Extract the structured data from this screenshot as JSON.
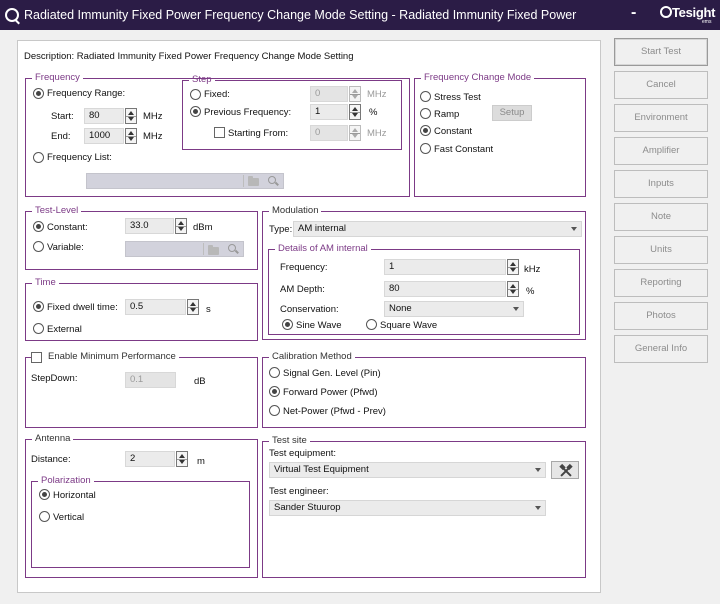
{
  "window": {
    "title": "Radiated Immunity Fixed Power Frequency Change Mode Setting - Radiated Immunity Fixed Power",
    "minimize_glyph": "-",
    "logo_text": "Tesight",
    "logo_subtext": "ems"
  },
  "description": "Description: Radiated Immunity Fixed Power Frequency Change Mode Setting",
  "frequency": {
    "legend": "Frequency",
    "range_label": "Frequency Range:",
    "start_label": "Start:",
    "start_value": "80",
    "start_unit": "MHz",
    "end_label": "End:",
    "end_value": "1000",
    "end_unit": "MHz",
    "list_label": "Frequency List:"
  },
  "step": {
    "legend": "Step",
    "fixed_label": "Fixed:",
    "fixed_value": "0",
    "fixed_unit": "MHz",
    "previous_label": "Previous Frequency:",
    "previous_value": "1",
    "previous_unit": "%",
    "starting_label": "Starting From:",
    "starting_value": "0",
    "starting_unit": "MHz"
  },
  "change_mode": {
    "legend": "Frequency Change Mode",
    "stress_label": "Stress Test",
    "ramp_label": "Ramp",
    "setup_label": "Setup",
    "constant_label": "Constant",
    "fast_label": "Fast Constant"
  },
  "test_level": {
    "legend": "Test-Level",
    "constant_label": "Constant:",
    "constant_value": "33.0",
    "constant_unit": "dBm",
    "variable_label": "Variable:"
  },
  "modulation": {
    "legend": "Modulation",
    "type_label": "Type:",
    "type_value": "AM internal",
    "details_legend": "Details of AM internal",
    "frequency_label": "Frequency:",
    "frequency_value": "1",
    "frequency_unit": "kHz",
    "depth_label": "AM Depth:",
    "depth_value": "80",
    "depth_unit": "%",
    "conservation_label": "Conservation:",
    "conservation_value": "None",
    "sine_label": "Sine Wave",
    "square_label": "Square Wave"
  },
  "time": {
    "legend": "Time",
    "dwell_label": "Fixed dwell time:",
    "dwell_value": "0.5",
    "dwell_unit": "s",
    "external_label": "External"
  },
  "min_perf": {
    "legend": "Enable Minimum Performance",
    "stepdown_label": "StepDown:",
    "stepdown_value": "0.1",
    "stepdown_unit": "dB"
  },
  "calibration": {
    "legend": "Calibration Method",
    "signal_label": "Signal Gen. Level (Pin)",
    "forward_label": "Forward Power (Pfwd)",
    "net_label": "Net-Power (Pfwd - Prev)"
  },
  "antenna": {
    "legend": "Antenna",
    "distance_label": "Distance:",
    "distance_value": "2",
    "distance_unit": "m",
    "polarization_legend": "Polarization",
    "horizontal_label": "Horizontal",
    "vertical_label": "Vertical"
  },
  "test_site": {
    "legend": "Test site",
    "equipment_label": "Test equipment:",
    "equipment_value": "Virtual Test Equipment",
    "engineer_label": "Test engineer:",
    "engineer_value": "Sander Stuurop"
  },
  "side_buttons": {
    "start_test": "Start Test",
    "cancel": "Cancel",
    "environment": "Environment",
    "amplifier": "Amplifier",
    "inputs": "Inputs",
    "note": "Note",
    "units": "Units",
    "reporting": "Reporting",
    "photos": "Photos",
    "general_info": "General Info"
  },
  "colors": {
    "title_bar": "#2b1c46",
    "group_accent": "#7c3a86",
    "field_bg": "#ebebeb",
    "disabled_text": "#9a9a9a"
  }
}
